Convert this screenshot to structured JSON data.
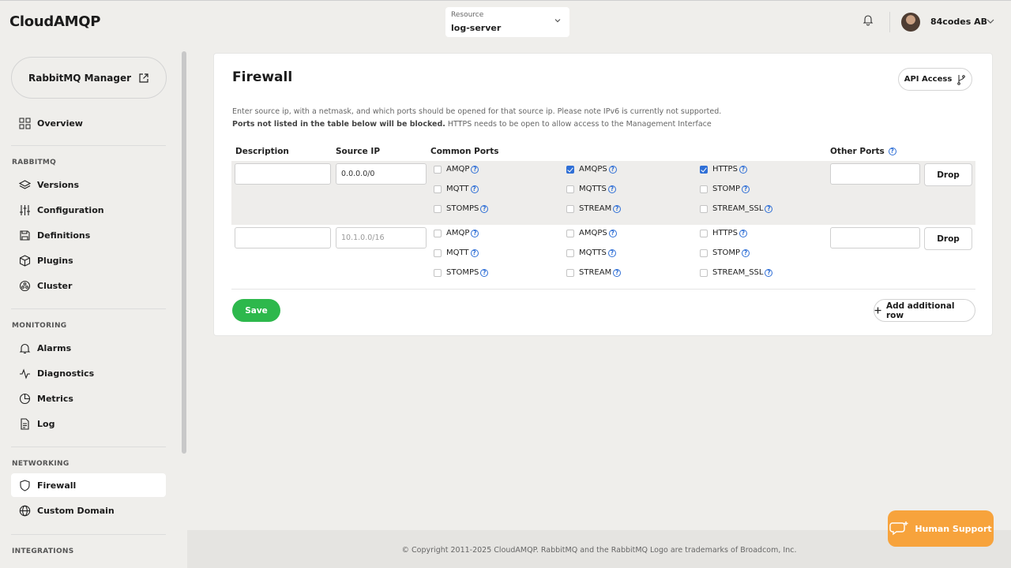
{
  "topbar": {
    "brand": "CloudAMQP",
    "resource_label": "Resource",
    "resource_value": "log-server",
    "org_name": "84codes AB"
  },
  "sidebar": {
    "rabbitmq_manager": "RabbitMQ Manager",
    "overview": "Overview",
    "section_rabbitmq": "RABBITMQ",
    "versions": "Versions",
    "configuration": "Configuration",
    "definitions": "Definitions",
    "plugins": "Plugins",
    "cluster": "Cluster",
    "section_monitoring": "MONITORING",
    "alarms": "Alarms",
    "diagnostics": "Diagnostics",
    "metrics": "Metrics",
    "log": "Log",
    "section_networking": "NETWORKING",
    "firewall": "Firewall",
    "custom_domain": "Custom Domain",
    "section_integrations": "INTEGRATIONS"
  },
  "firewall": {
    "title": "Firewall",
    "api_access": "API Access",
    "desc1": "Enter source ip, with a netmask, and which ports should be opened for that source ip. Please note IPv6 is currently not supported.",
    "desc2_bold": "Ports not listed in the table below will be blocked.",
    "desc2_rest": " HTTPS needs to be open to allow access to the Management Interface",
    "headers": {
      "description": "Description",
      "source_ip": "Source IP",
      "common_ports": "Common Ports",
      "other_ports": "Other Ports"
    },
    "rows": [
      {
        "description": "",
        "source_ip": "0.0.0.0/0",
        "other_ports": "",
        "ports": {
          "amqp": "AMQP",
          "amqps": "AMQPS",
          "https": "HTTPS",
          "mqtt": "MQTT",
          "mqtts": "MQTTS",
          "stomp": "STOMP",
          "stomps": "STOMPS",
          "stream": "STREAM",
          "stream_ssl": "STREAM_SSL"
        },
        "checked": [
          "AMQPS",
          "HTTPS"
        ],
        "drop": "Drop"
      },
      {
        "description": "",
        "source_ip_placeholder": "10.1.0.0/16",
        "other_ports": "",
        "ports": {
          "amqp": "AMQP",
          "amqps": "AMQPS",
          "https": "HTTPS",
          "mqtt": "MQTT",
          "mqtts": "MQTTS",
          "stomp": "STOMP",
          "stomps": "STOMPS",
          "stream": "STREAM",
          "stream_ssl": "STREAM_SSL"
        },
        "checked": [],
        "drop": "Drop"
      }
    ],
    "save": "Save",
    "add_row": "Add additional row"
  },
  "footer": {
    "copyright": "© Copyright 2011-2025 CloudAMQP. RabbitMQ and the RabbitMQ Logo are trademarks of Broadcom, Inc."
  },
  "support": {
    "label": "Human Support"
  }
}
